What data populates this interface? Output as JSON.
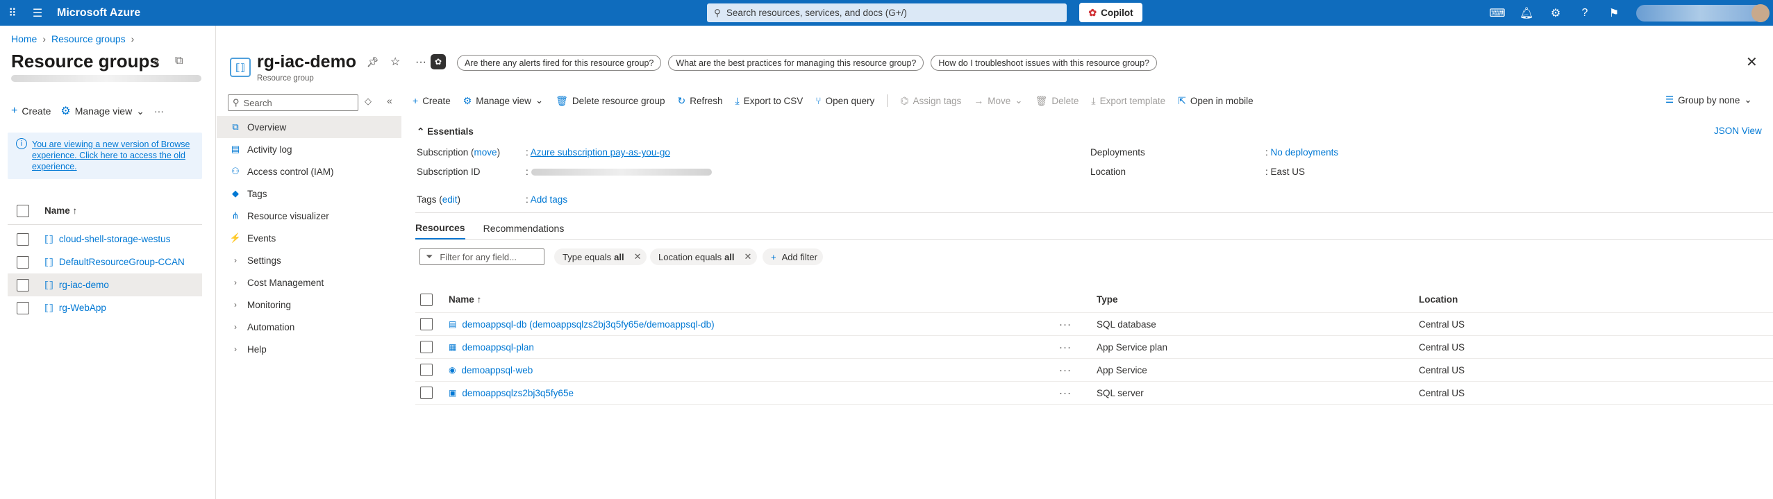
{
  "topbar": {
    "brand": "Microsoft Azure",
    "search_placeholder": "Search resources, services, and docs (G+/)",
    "copilot_label": "Copilot"
  },
  "left_pane": {
    "breadcrumb": [
      "Home",
      "Resource groups"
    ],
    "title": "Resource groups",
    "commands": {
      "create": "Create",
      "manage_view": "Manage view",
      "more": "···"
    },
    "info_text": "You are viewing a new version of Browse experience. Click here to access the old experience.",
    "name_header": "Name ↑",
    "groups": [
      {
        "name": "cloud-shell-storage-westus",
        "selected": false
      },
      {
        "name": "DefaultResourceGroup-CCAN",
        "selected": false
      },
      {
        "name": "rg-iac-demo",
        "selected": true
      },
      {
        "name": "rg-WebApp",
        "selected": false
      }
    ]
  },
  "resource_group": {
    "title": "rg-iac-demo",
    "subtitle": "Resource group",
    "menu_search_placeholder": "Search",
    "menu_items": [
      {
        "label": "Overview",
        "icon": "overview-icon",
        "glyph": "⧉",
        "expandable": false,
        "active": true
      },
      {
        "label": "Activity log",
        "icon": "activity-log-icon",
        "glyph": "▤",
        "expandable": false,
        "active": false
      },
      {
        "label": "Access control (IAM)",
        "icon": "iam-icon",
        "glyph": "⚇",
        "expandable": false,
        "active": false
      },
      {
        "label": "Tags",
        "icon": "tag-icon",
        "glyph": "◆",
        "expandable": false,
        "active": false
      },
      {
        "label": "Resource visualizer",
        "icon": "visualizer-icon",
        "glyph": "⋔",
        "expandable": false,
        "active": false
      },
      {
        "label": "Events",
        "icon": "lightning-icon",
        "glyph": "⚡",
        "expandable": false,
        "active": false
      },
      {
        "label": "Settings",
        "icon": "chevron-right-icon",
        "glyph": "›",
        "expandable": true,
        "active": false
      },
      {
        "label": "Cost Management",
        "icon": "chevron-right-icon",
        "glyph": "›",
        "expandable": true,
        "active": false
      },
      {
        "label": "Monitoring",
        "icon": "chevron-right-icon",
        "glyph": "›",
        "expandable": true,
        "active": false
      },
      {
        "label": "Automation",
        "icon": "chevron-right-icon",
        "glyph": "›",
        "expandable": true,
        "active": false
      },
      {
        "label": "Help",
        "icon": "chevron-right-icon",
        "glyph": "›",
        "expandable": true,
        "active": false
      }
    ]
  },
  "main": {
    "suggestions": [
      "Are there any alerts fired for this resource group?",
      "What are the best practices for managing this resource group?",
      "How do I troubleshoot issues with this resource group?"
    ],
    "toolbar": {
      "create": "Create",
      "manage_view": "Manage view",
      "delete_rg": "Delete resource group",
      "refresh": "Refresh",
      "export_csv": "Export to CSV",
      "open_query": "Open query",
      "assign_tags": "Assign tags",
      "move": "Move",
      "delete": "Delete",
      "export_template": "Export template",
      "open_mobile": "Open in mobile",
      "group_by": "Group by none"
    },
    "essentials": {
      "heading": "Essentials",
      "json_view": "JSON View",
      "subscription_label": "Subscription (",
      "subscription_move": "move",
      "subscription_close": ")",
      "subscription_value": "Azure subscription pay-as-you-go",
      "subscription_id_label": "Subscription ID",
      "tags_label": "Tags (",
      "tags_edit": "edit",
      "tags_close": ")",
      "tags_value": "Add tags",
      "deployments_label": "Deployments",
      "deployments_value": "No deployments",
      "location_label": "Location",
      "location_value": "East US",
      "separator": ":"
    },
    "tabs": [
      "Resources",
      "Recommendations"
    ],
    "filter_placeholder": "Filter for any field...",
    "filters": [
      {
        "label": "Type equals",
        "value": "all"
      },
      {
        "label": "Location equals",
        "value": "all"
      }
    ],
    "add_filter": "Add filter",
    "table": {
      "headers": {
        "name": "Name ↑",
        "type": "Type",
        "location": "Location"
      },
      "rows": [
        {
          "name": "demoappsql-db (demoappsqlzs2bj3q5fy65e/demoappsql-db)",
          "type": "SQL database",
          "location": "Central US",
          "icon": "sql-database-icon",
          "glyph": "▤"
        },
        {
          "name": "demoappsql-plan",
          "type": "App Service plan",
          "location": "Central US",
          "icon": "app-service-plan-icon",
          "glyph": "▦"
        },
        {
          "name": "demoappsql-web",
          "type": "App Service",
          "location": "Central US",
          "icon": "app-service-icon",
          "glyph": "◉"
        },
        {
          "name": "demoappsqlzs2bj3q5fy65e",
          "type": "SQL server",
          "location": "Central US",
          "icon": "sql-server-icon",
          "glyph": "▣"
        }
      ]
    }
  },
  "colors": {
    "topbar": "#0f6cbd",
    "accent": "#0078d4",
    "selected_row": "#edebe9"
  }
}
